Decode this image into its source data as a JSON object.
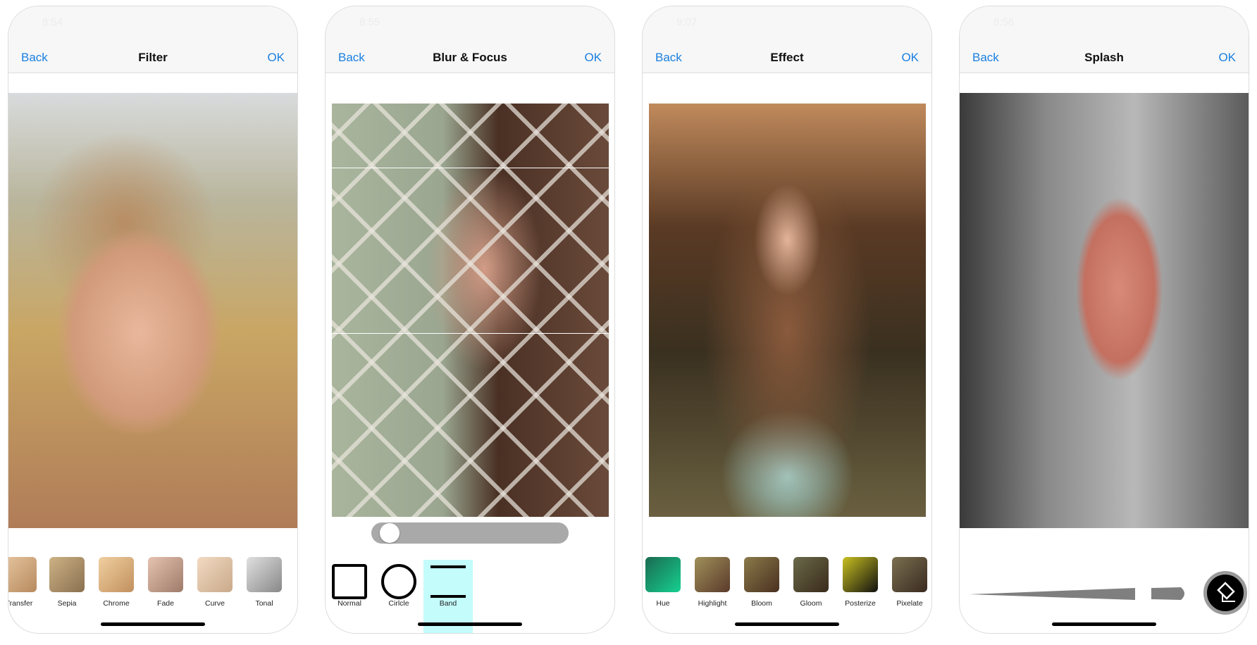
{
  "screens": [
    {
      "status_time": "8:54",
      "back": "Back",
      "title": "Filter",
      "ok": "OK",
      "items": [
        "Transfer",
        "Sepia",
        "Chrome",
        "Fade",
        "Curve",
        "Tonal"
      ]
    },
    {
      "status_time": "8:55",
      "back": "Back",
      "title": "Blur & Focus",
      "ok": "OK",
      "slider_value": 0.05,
      "modes": [
        "Normal",
        "Cirlcle",
        "Band"
      ],
      "selected_mode": "Band",
      "selected_color": "#c4fbfb"
    },
    {
      "status_time": "9:07",
      "back": "Back",
      "title": "Effect",
      "ok": "OK",
      "items": [
        "Hue",
        "Highlight",
        "Bloom",
        "Gloom",
        "Posterize",
        "Pixelate"
      ]
    },
    {
      "status_time": "8:56",
      "back": "Back",
      "title": "Splash",
      "ok": "OK",
      "eraser_icon": "eraser-icon"
    }
  ],
  "colors": {
    "accent": "#1a7fe0"
  }
}
